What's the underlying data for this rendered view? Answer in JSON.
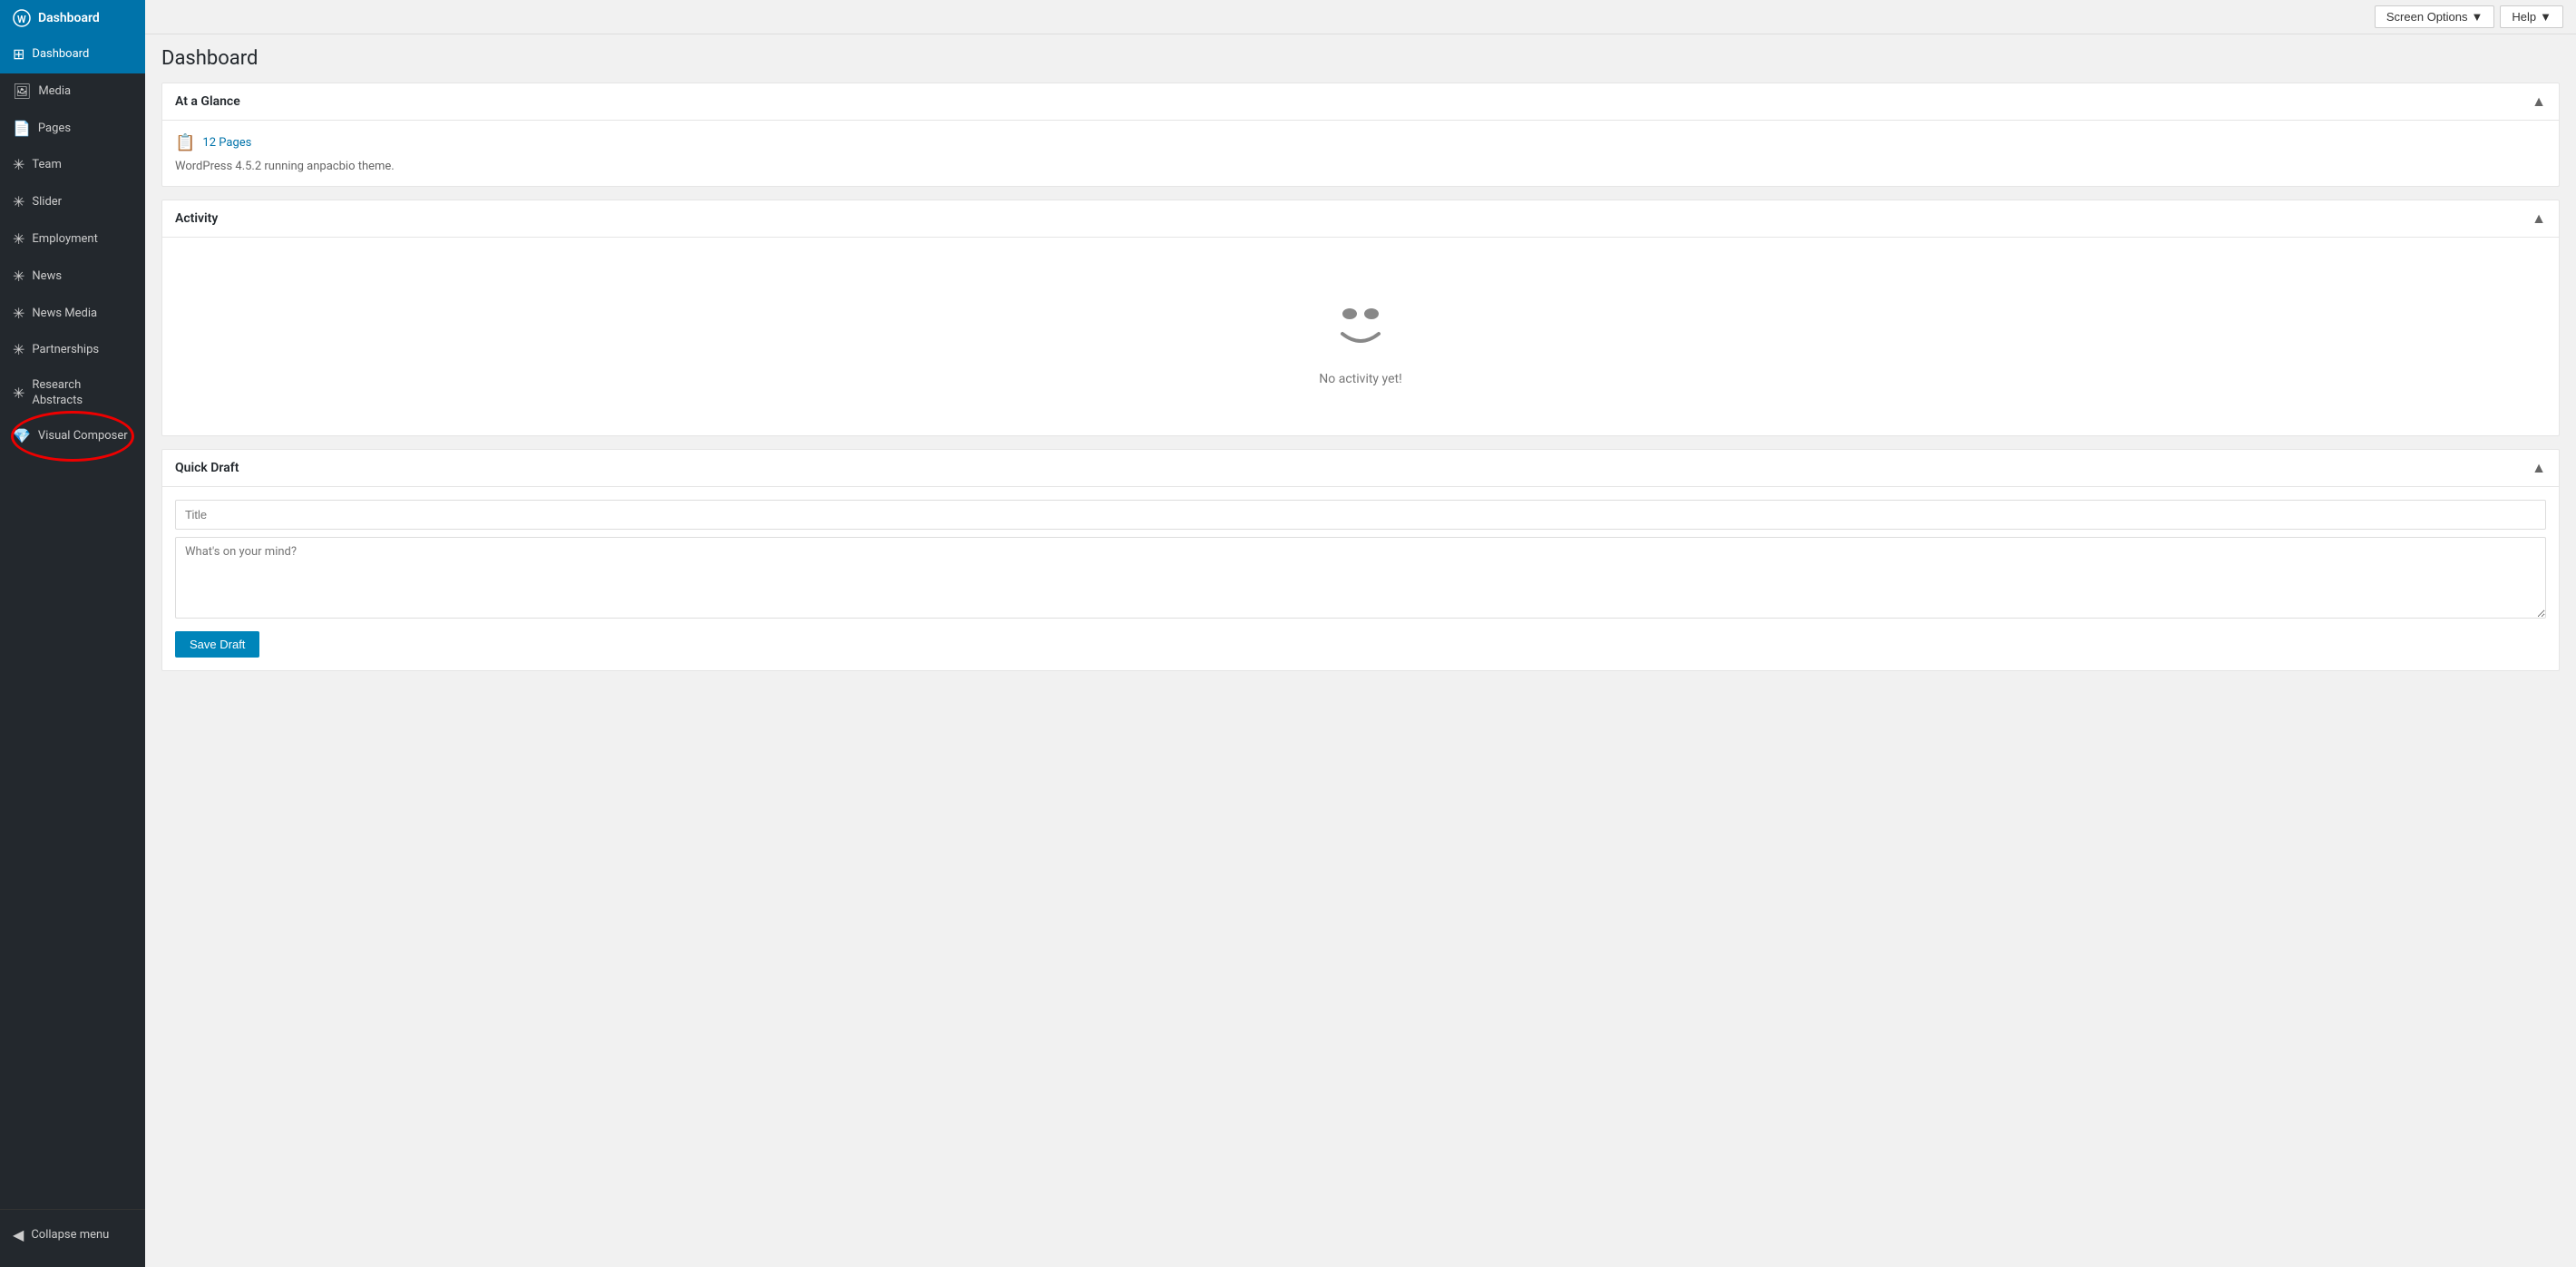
{
  "sidebar": {
    "logo_label": "Dashboard",
    "items": [
      {
        "id": "dashboard",
        "label": "Dashboard",
        "icon": "⊞",
        "active": true
      },
      {
        "id": "media",
        "label": "Media",
        "icon": "🖼"
      },
      {
        "id": "pages",
        "label": "Pages",
        "icon": "📄"
      },
      {
        "id": "team",
        "label": "Team",
        "icon": "✳"
      },
      {
        "id": "slider",
        "label": "Slider",
        "icon": "✳"
      },
      {
        "id": "employment",
        "label": "Employment",
        "icon": "✳"
      },
      {
        "id": "news",
        "label": "News",
        "icon": "✳"
      },
      {
        "id": "news-media",
        "label": "News Media",
        "icon": "✳"
      },
      {
        "id": "partnerships",
        "label": "Partnerships",
        "icon": "✳"
      },
      {
        "id": "research-abstracts",
        "label": "Research Abstracts",
        "icon": "✳"
      },
      {
        "id": "visual-composer",
        "label": "Visual Composer",
        "icon": "💎"
      }
    ],
    "collapse_label": "Collapse menu"
  },
  "topbar": {
    "screen_options_label": "Screen Options",
    "help_label": "Help"
  },
  "main": {
    "title": "Dashboard",
    "at_a_glance": {
      "heading": "At a Glance",
      "pages_count": "12 Pages",
      "wp_info": "WordPress 4.5.2 running anpacbio theme."
    },
    "activity": {
      "heading": "Activity",
      "empty_text": "No activity yet!"
    },
    "quick_draft": {
      "heading": "Quick Draft",
      "title_placeholder": "Title",
      "content_placeholder": "What's on your mind?",
      "save_label": "Save Draft"
    }
  }
}
